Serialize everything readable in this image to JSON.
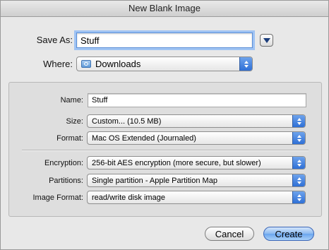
{
  "window": {
    "title": "New Blank Image"
  },
  "save": {
    "save_as_label": "Save As:",
    "save_as_value": "Stuff",
    "where_label": "Where:",
    "where_value": "Downloads"
  },
  "options": {
    "name_label": "Name:",
    "name_value": "Stuff",
    "size_label": "Size:",
    "size_value": "Custom... (10.5 MB)",
    "format_label": "Format:",
    "format_value": "Mac OS Extended (Journaled)",
    "encryption_label": "Encryption:",
    "encryption_value": "256-bit AES encryption (more secure, but slower)",
    "partitions_label": "Partitions:",
    "partitions_value": "Single partition - Apple Partition Map",
    "image_format_label": "Image Format:",
    "image_format_value": "read/write disk image"
  },
  "buttons": {
    "cancel_label": "Cancel",
    "create_label": "Create"
  },
  "icons": {
    "disclosure": "chevron-down-icon",
    "folder": "downloads-folder-icon",
    "popup_arrows": "updown-arrows-icon"
  },
  "colors": {
    "accent": "#3a7bd5",
    "focus_ring": "#9fc3f3"
  }
}
